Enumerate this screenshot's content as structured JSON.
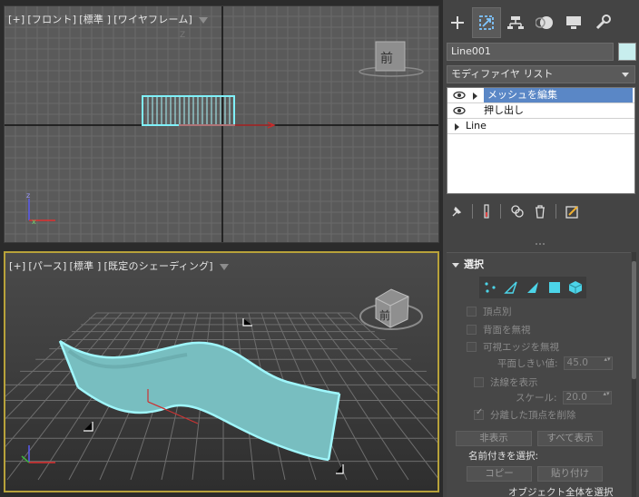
{
  "viewports": {
    "front": {
      "label_plus": "[+]",
      "label_view": "[フロント]",
      "label_mode": "[標準 ]",
      "label_shading": "[ワイヤフレーム]",
      "axis_z": "Z",
      "viewcube_face": "前"
    },
    "perspective": {
      "label_plus": "[+]",
      "label_view": "[パース]",
      "label_mode": "[標準 ]",
      "label_shading": "[既定のシェーディング]",
      "viewcube_face": "前",
      "active_border_color": "#b8a23a"
    }
  },
  "panel": {
    "tabs": [
      "create-icon",
      "modify-icon",
      "hierarchy-icon",
      "motion-icon",
      "display-icon",
      "utilities-icon"
    ],
    "active_tab": 1,
    "object_name": "Line001",
    "object_color": "#c8eeee",
    "modifier_list_label": "モディファイヤ リスト",
    "stack": [
      {
        "label": "メッシュを編集",
        "selected": true,
        "eye": true
      },
      {
        "label": "押し出し",
        "selected": false,
        "eye": true
      },
      {
        "label": "Line",
        "selected": false,
        "eye": false
      }
    ],
    "rollout": {
      "title": "選択",
      "by_vertex": "頂点別",
      "ignore_backface": "背面を無視",
      "ignore_visible_edges": "可視エッジを無視",
      "planar_threshold_label": "平面しきい値:",
      "planar_threshold_value": "45.0",
      "show_normals": "法線を表示",
      "scale_label": "スケール:",
      "scale_value": "20.0",
      "delete_isolated": "分離した頂点を削除",
      "hide_button": "非表示",
      "show_all_button": "すべて表示",
      "named_selection_label": "名前付きを選択:",
      "copy_button": "コピー",
      "paste_button": "貼り付け",
      "cutoff_text": "オブジェクト全体を選択"
    }
  }
}
